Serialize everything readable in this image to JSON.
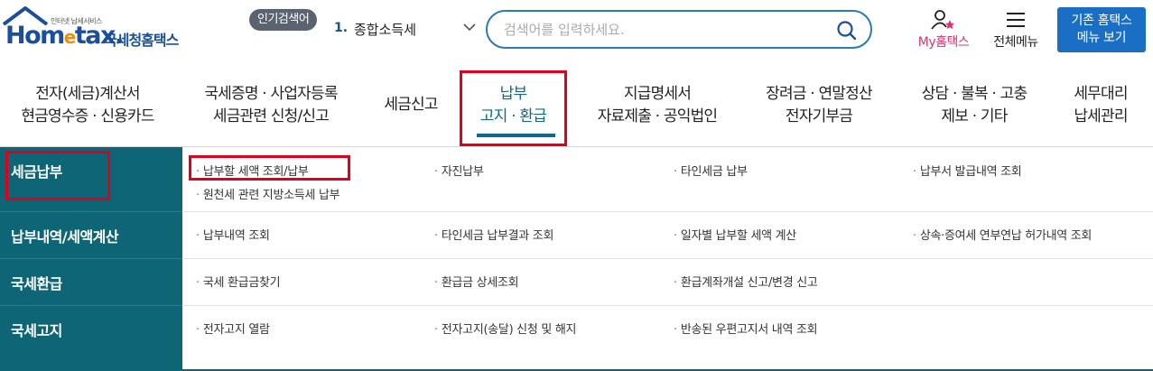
{
  "header": {
    "logo_small": "인터넷 납세서비스",
    "logo_main_pre": "Hom",
    "logo_main_e": "e",
    "logo_main_post": "tax.",
    "logo_kr": "국세청홈택스",
    "popular_badge": "인기검색어",
    "popular_rank": "1.",
    "popular_term": "종합소득세",
    "search_placeholder": "검색어를 입력하세요.",
    "my_hometax": "My홈택스",
    "all_menu": "전체메뉴",
    "old_menu_line1": "기존 홈택스",
    "old_menu_line2": "메뉴 보기"
  },
  "nav": [
    {
      "line1": "전자(세금)계산서",
      "line2": "현금영수증 · 신용카드"
    },
    {
      "line1": "국세증명 · 사업자등록",
      "line2": "세금관련 신청/신고"
    },
    {
      "line1": "세금신고",
      "line2": ""
    },
    {
      "line1": "납부",
      "line2": "고지 · 환급"
    },
    {
      "line1": "지급명세서",
      "line2": "자료제출 · 공익법인"
    },
    {
      "line1": "장려금 · 연말정산",
      "line2": "전자기부금"
    },
    {
      "line1": "상담 · 불복 · 고충",
      "line2": "제보 · 기타"
    },
    {
      "line1": "세무대리",
      "line2": "납세관리"
    }
  ],
  "submenu": {
    "categories": [
      "세금납부",
      "납부내역/세액계산",
      "국세환급",
      "국세고지"
    ],
    "row1": [
      "납부할 세액 조회/납부",
      "자진납부",
      "타인세금 납부",
      "납부서 발급내역 조회",
      "원천세 관련 지방소득세 납부"
    ],
    "row2": [
      "납부내역 조회",
      "타인세금 납부결과 조회",
      "일자별 납부할 세액 계산",
      "상속·증여세 연부연납 허가내역 조회"
    ],
    "row3": [
      "국세 환급금찾기",
      "환급금 상세조회",
      "환급계좌개설 신고/변경 신고"
    ],
    "row4": [
      "전자고지 열람",
      "전자고지(송달) 신청 및 해지",
      "반송된 우편고지서 내역 조회"
    ]
  },
  "colors": {
    "brand_blue": "#1b4f9c",
    "accent_orange": "#f28c00",
    "teal": "#0e6576",
    "highlight_red": "#e0001b",
    "button_blue": "#1a6fc4",
    "my_pink": "#e0336b"
  },
  "icons": {
    "search": "magnifier-icon",
    "my": "user-star-icon",
    "menu": "hamburger-icon",
    "dropdown": "chevron-down-icon"
  }
}
